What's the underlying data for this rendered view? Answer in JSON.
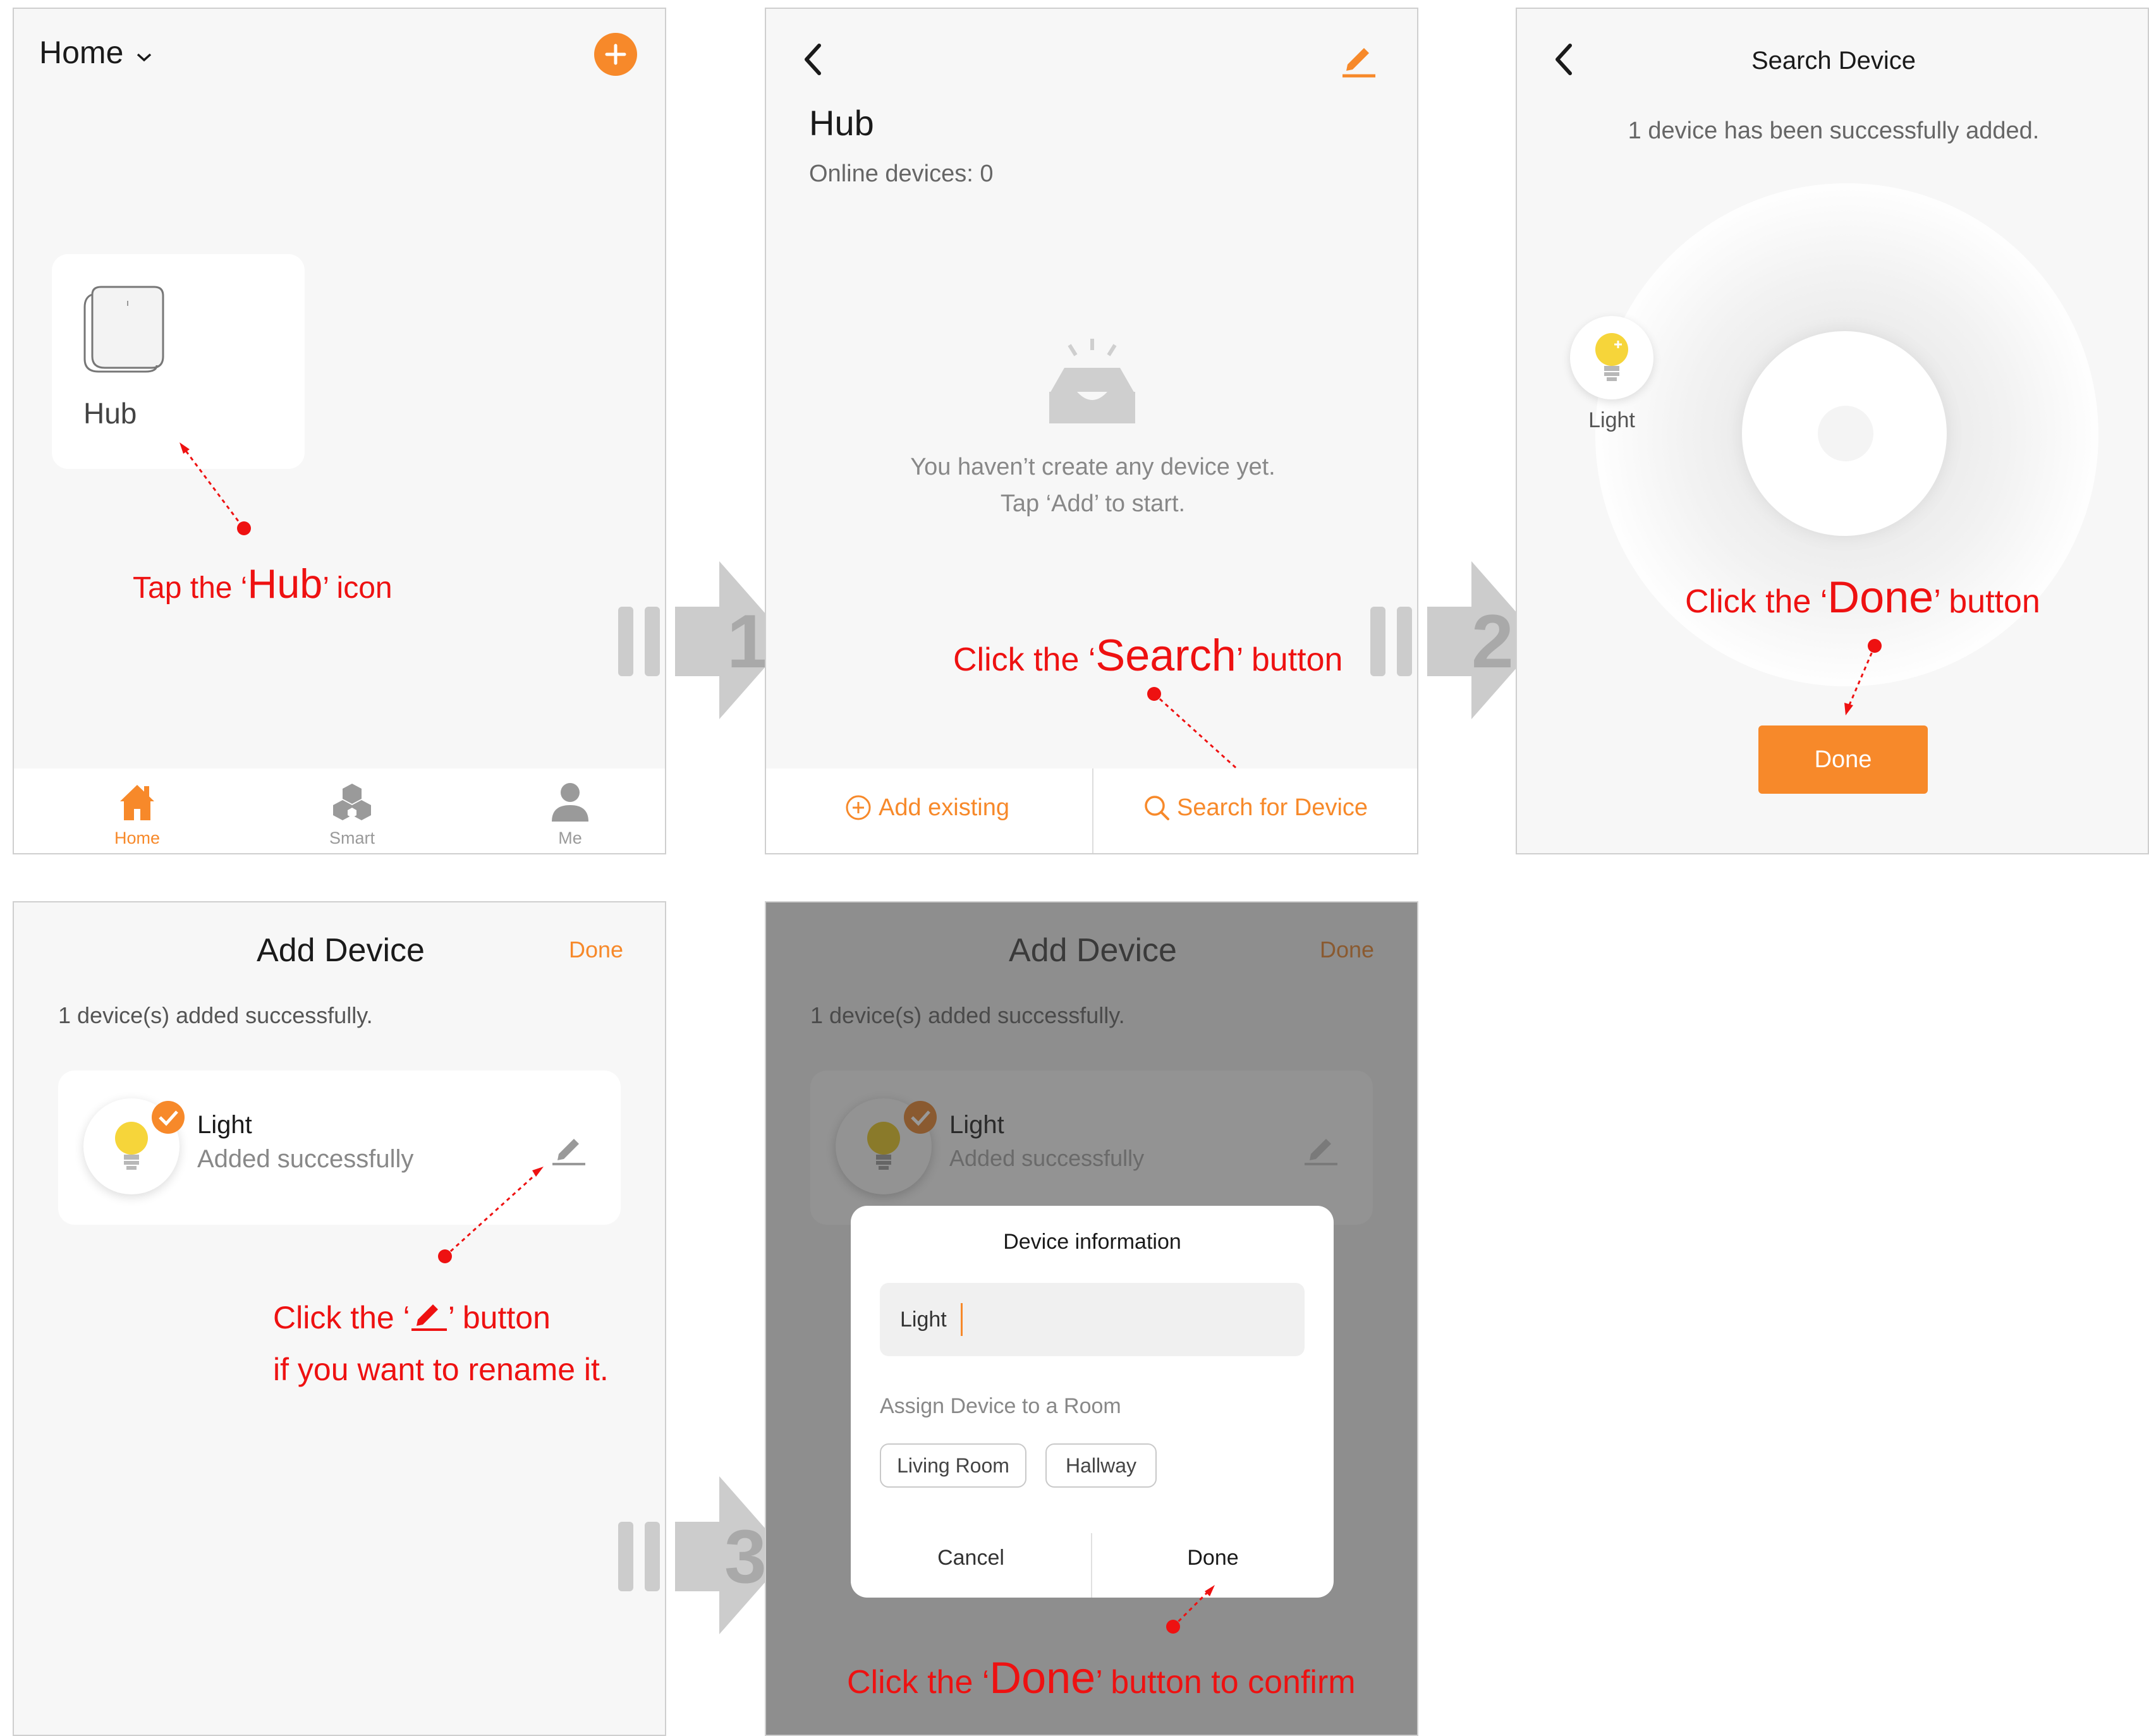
{
  "screen1": {
    "home_title": "Home",
    "hub_label": "Hub",
    "tabs": [
      {
        "label": "Home",
        "icon": "home-icon"
      },
      {
        "label": "Smart",
        "icon": "smart-icon"
      },
      {
        "label": "Me",
        "icon": "person-icon"
      }
    ],
    "ann": {
      "pre": "Tap the ‘",
      "key": "Hub",
      "post": "’ icon"
    }
  },
  "screen2": {
    "title": "Hub",
    "online": "Online devices: 0",
    "empty_line1": "You haven’t create any device yet.",
    "empty_line2": "Tap ‘Add’ to start.",
    "add_existing": "Add existing",
    "search_device": "Search for Device",
    "ann": {
      "pre": "Click the ‘",
      "key": "Search",
      "post": "’ button"
    }
  },
  "screen3": {
    "title": "Search Device",
    "message": "1 device has been successfully added.",
    "device_label": "Light",
    "done_button": "Done",
    "ann": {
      "pre": "Click the ‘",
      "key": "Done",
      "post": "’ button"
    }
  },
  "screen4": {
    "title": "Add Device",
    "done_link": "Done",
    "subtitle": "1 device(s) added successfully.",
    "device_name": "Light",
    "device_status": "Added successfully",
    "ann_line1_pre": "Click the ‘",
    "ann_line1_post": "’ button",
    "ann_line2": "if you want to rename it."
  },
  "screen5": {
    "title": "Add Device",
    "done_link": "Done",
    "subtitle": "1 device(s) added successfully.",
    "device_name": "Light",
    "device_status": "Added successfully",
    "dialog": {
      "title": "Device information",
      "name_value": "Light",
      "room_label": "Assign Device to a Room",
      "rooms": [
        "Living Room",
        "Hallway"
      ],
      "cancel": "Cancel",
      "done": "Done"
    },
    "ann": {
      "pre": "Click the ‘",
      "key": "Done",
      "post": "’ button to confirm"
    }
  },
  "steps": [
    "1",
    "2",
    "3"
  ],
  "colors": {
    "accent": "#f7892a",
    "annotation": "#ee1111",
    "arrow": "#cccccc"
  }
}
